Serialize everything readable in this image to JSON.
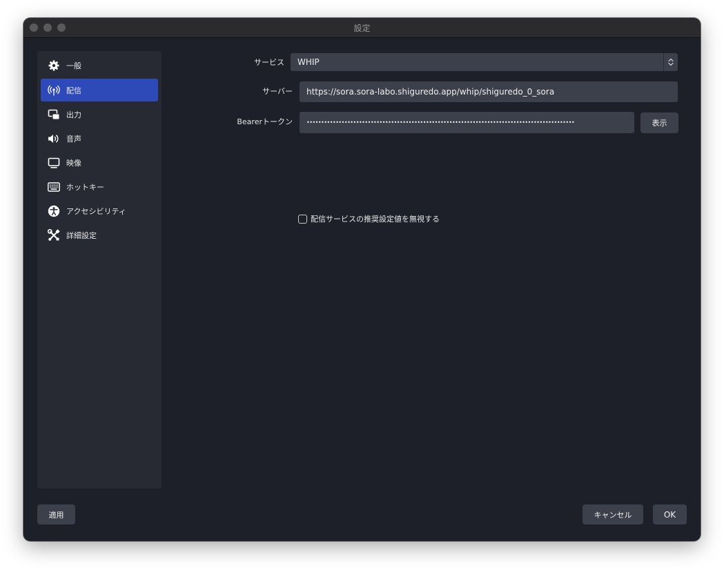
{
  "window": {
    "title": "設定"
  },
  "sidebar": {
    "items": [
      {
        "label": "一般",
        "icon": "gear-icon"
      },
      {
        "label": "配信",
        "icon": "broadcast-icon",
        "active": true
      },
      {
        "label": "出力",
        "icon": "output-icon"
      },
      {
        "label": "音声",
        "icon": "speaker-icon"
      },
      {
        "label": "映像",
        "icon": "monitor-icon"
      },
      {
        "label": "ホットキー",
        "icon": "keyboard-icon"
      },
      {
        "label": "アクセシビリティ",
        "icon": "accessibility-icon"
      },
      {
        "label": "詳細設定",
        "icon": "tools-icon"
      }
    ]
  },
  "form": {
    "service_label": "サービス",
    "service_value": "WHIP",
    "server_label": "サーバー",
    "server_value": "https://sora.sora-labo.shiguredo.app/whip/shiguredo_0_sora",
    "token_label": "Bearerトークン",
    "token_value": "••••••••••••••••••••••••••••••••••••••••••••••••••••••••••••••••••••••••••••••••••••••••••••",
    "show_label": "表示",
    "ignore_label": "配信サービスの推奨設定値を無視する"
  },
  "footer": {
    "apply_label": "適用",
    "cancel_label": "キャンセル",
    "ok_label": "OK"
  },
  "colors": {
    "accent": "#2d4ab8",
    "background": "#1e2029",
    "panel": "#272a33",
    "control": "#3c404b"
  }
}
